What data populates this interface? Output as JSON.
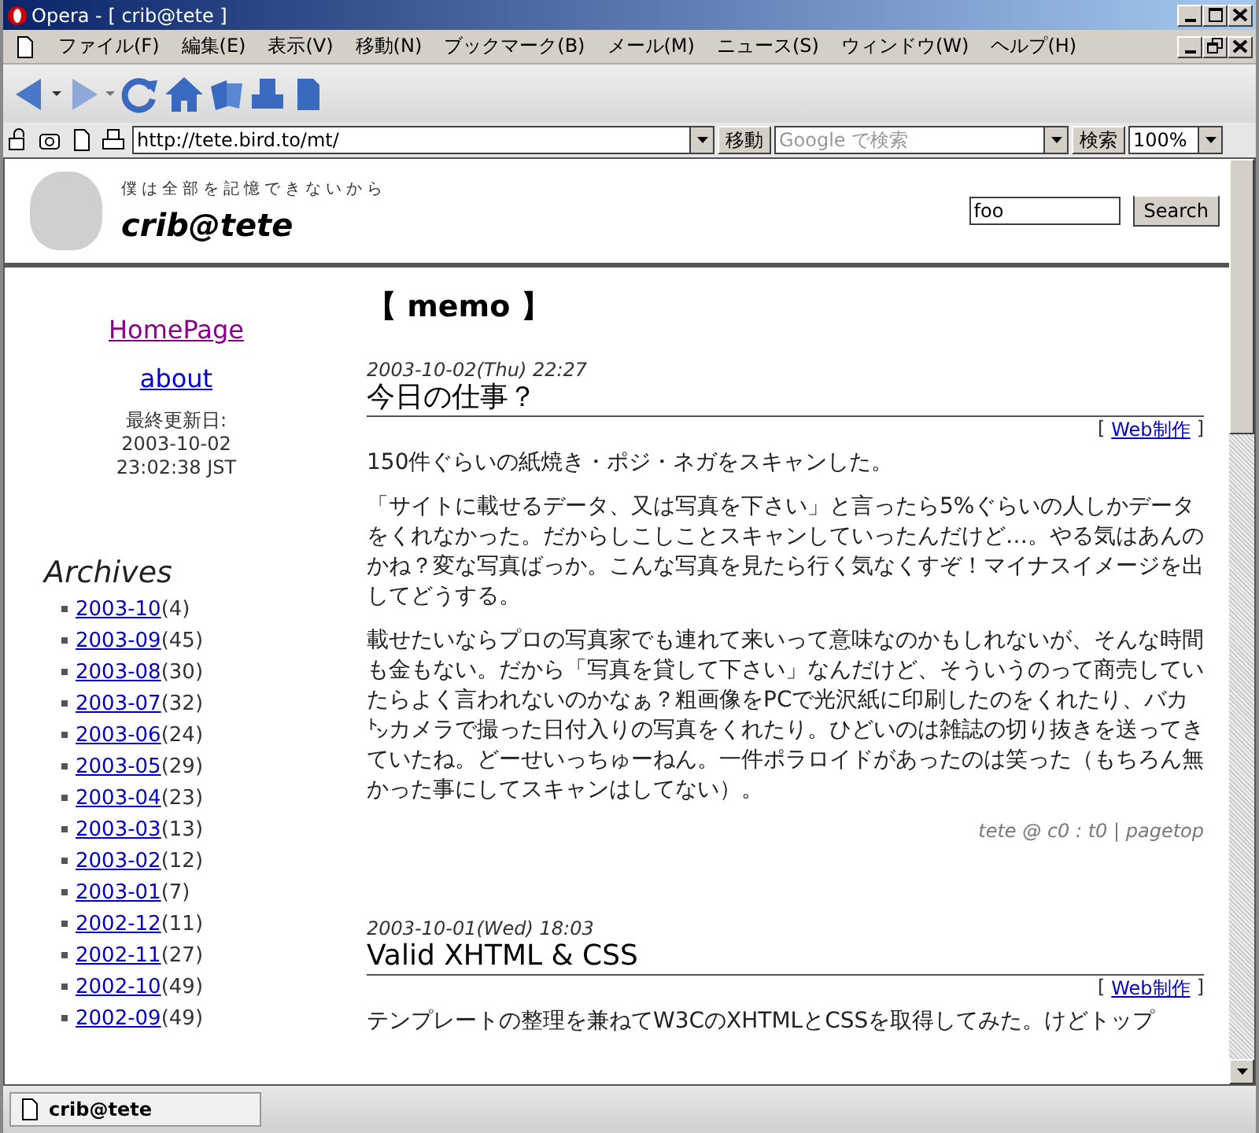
{
  "window": {
    "title": "Opera - [ crib@tete ]"
  },
  "menu": [
    {
      "label": "ファイル(F)"
    },
    {
      "label": "編集(E)"
    },
    {
      "label": "表示(V)"
    },
    {
      "label": "移動(N)"
    },
    {
      "label": "ブックマーク(B)"
    },
    {
      "label": "メール(M)"
    },
    {
      "label": "ニュース(S)"
    },
    {
      "label": "ウィンドウ(W)"
    },
    {
      "label": "ヘルプ(H)"
    }
  ],
  "address_bar": {
    "url": "http://tete.bird.to/mt/",
    "go_button": "移動",
    "search_placeholder": "Google で検索",
    "search_button": "検索",
    "zoom": "100%"
  },
  "page": {
    "tagline": "僕は全部を記憶できないから",
    "site_title": "crib@tete",
    "search_value": "foo",
    "search_button": "Search",
    "sidebar": {
      "links": [
        {
          "label": "HomePage",
          "visited": true
        },
        {
          "label": "about",
          "visited": false
        }
      ],
      "updated_label": "最終更新日:",
      "updated_date": "2003-10-02",
      "updated_time": "23:02:38 JST",
      "archives_title": "Archives",
      "archives": [
        {
          "month": "2003-10",
          "count": "(4)"
        },
        {
          "month": "2003-09",
          "count": "(45)"
        },
        {
          "month": "2003-08",
          "count": "(30)"
        },
        {
          "month": "2003-07",
          "count": "(32)"
        },
        {
          "month": "2003-06",
          "count": "(24)"
        },
        {
          "month": "2003-05",
          "count": "(29)"
        },
        {
          "month": "2003-04",
          "count": "(23)"
        },
        {
          "month": "2003-03",
          "count": "(13)"
        },
        {
          "month": "2003-02",
          "count": "(12)"
        },
        {
          "month": "2003-01",
          "count": "(7)"
        },
        {
          "month": "2002-12",
          "count": "(11)"
        },
        {
          "month": "2002-11",
          "count": "(27)"
        },
        {
          "month": "2002-10",
          "count": "(49)"
        },
        {
          "month": "2002-09",
          "count": "(49)"
        }
      ]
    },
    "section_title": "【 memo 】",
    "entries": [
      {
        "date": "2003-10-02(Thu) 22:27",
        "title": "今日の仕事？",
        "category_open": "[",
        "category": "Web制作",
        "category_close": "]",
        "paragraphs": [
          "150件ぐらいの紙焼き・ポジ・ネガをスキャンした。",
          "「サイトに載せるデータ、又は写真を下さい」と言ったら5%ぐらいの人しかデータをくれなかった。だからしこしことスキャンしていったんだけど…。やる気はあんのかね？変な写真ばっか。こんな写真を見たら行く気なくすぞ！マイナスイメージを出してどうする。",
          "載せたいならプロの写真家でも連れて来いって意味なのかもしれないが、そんな時間も金もない。だから「写真を貸して下さい」なんだけど、そういうのって商売していたらよく言われないのかなぁ？粗画像をPCで光沢紙に印刷したのをくれたり、バカ㌧カメラで撮った日付入りの写真をくれたり。ひどいのは雑誌の切り抜きを送ってきていたね。どーせいっちゅーねん。一件ポラロイドがあったのは笑った（もちろん無かった事にしてスキャンはしてない）。"
        ],
        "footer": "tete @ c0 : t0 | pagetop"
      },
      {
        "date": "2003-10-01(Wed) 18:03",
        "title": "Valid XHTML & CSS",
        "category_open": "[",
        "category": "Web制作",
        "category_close": "]",
        "paragraphs": [
          "テンプレートの整理を兼ねてW3CのXHTMLとCSSを取得してみた。けどトップ"
        ]
      }
    ]
  },
  "status_bar": {
    "tab": "crib@tete"
  }
}
